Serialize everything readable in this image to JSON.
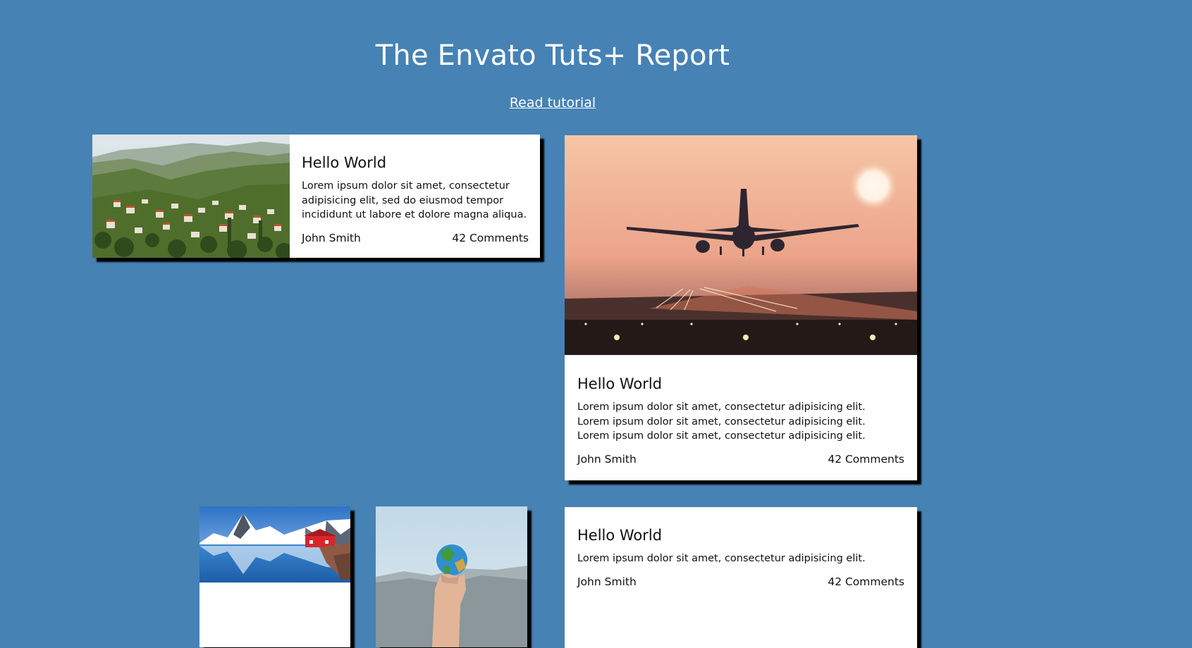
{
  "header": {
    "title": "The Envato Tuts+ Report",
    "link": "Read tutorial"
  },
  "cards": [
    {
      "image": "village-hillside-photo",
      "title": "Hello World",
      "text": "Lorem ipsum dolor sit amet, consectetur adipisicing elit, sed do eiusmod tempor incididunt ut labore et dolore magna aliqua.",
      "author": "John Smith",
      "comments": "42 Comments"
    },
    {
      "image": "airplane-landing-sunset-photo",
      "title": "Hello World",
      "text_lines": [
        "Lorem ipsum dolor sit amet, consectetur adipisicing elit.",
        "Lorem ipsum dolor sit amet, consectetur adipisicing elit.",
        "Lorem ipsum dolor sit amet, consectetur adipisicing elit."
      ],
      "author": "John Smith",
      "comments": "42 Comments"
    },
    {
      "image": "lofoten-mountains-red-house-photo"
    },
    {
      "image": "hand-holding-globe-photo"
    },
    {
      "title": "Hello World",
      "text": "Lorem ipsum dolor sit amet, consectetur adipisicing elit.",
      "author": "John Smith",
      "comments": "42 Comments"
    }
  ],
  "colors": {
    "background": "#4682b4",
    "card": "#ffffff",
    "shadow": "#000000"
  }
}
